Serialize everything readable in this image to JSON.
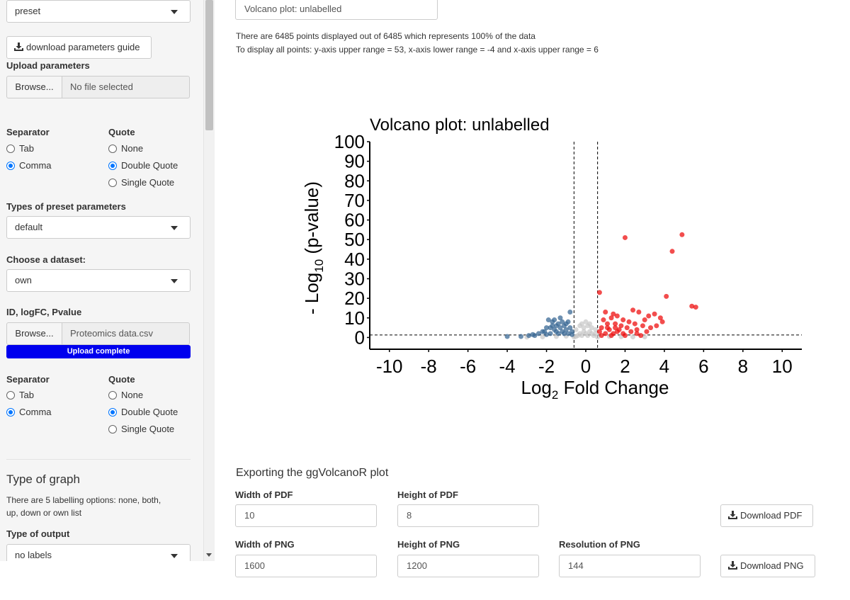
{
  "sidebar": {
    "preset_select": "preset",
    "download_guide_label": "download parameters guide",
    "upload_params_label": "Upload parameters",
    "browse_label": "Browse...",
    "no_file_text": "No file selected",
    "separator_label": "Separator",
    "quote_label": "Quote",
    "sep_tab": "Tab",
    "sep_comma": "Comma",
    "quote_none": "None",
    "quote_double": "Double Quote",
    "quote_single": "Single Quote",
    "types_preset_label": "Types of preset parameters",
    "types_preset_value": "default",
    "choose_dataset_label": "Choose a dataset:",
    "dataset_value": "own",
    "id_logfc_label": "ID, logFC, Pvalue",
    "data_file_name": "Proteomics data.csv",
    "upload_complete": "Upload complete",
    "upload_progress": 1.0,
    "type_of_graph_heading": "Type of graph",
    "labelling_options_line1": "There are 5 labelling options: none, both,",
    "labelling_options_line2": "up, down or own list",
    "type_of_output_label": "Type of output",
    "output_value": "no labels"
  },
  "main": {
    "title_input": "Volcano plot: unlabelled",
    "info_line1": "There are 6485 points displayed out of 6485 which represents 100% of the data",
    "info_line2": "To display all points: y-axis upper range = 53, x-axis lower range = -4 and x-axis upper range = 6",
    "export_heading": "Exporting the ggVolcanoR plot",
    "width_pdf_label": "Width of PDF",
    "width_pdf_value": "10",
    "height_pdf_label": "Height of PDF",
    "height_pdf_value": "8",
    "download_pdf_label": "Download PDF",
    "width_png_label": "Width of PNG",
    "width_png_value": "1600",
    "height_png_label": "Height of PNG",
    "height_png_value": "1200",
    "resolution_png_label": "Resolution of PNG",
    "resolution_png_value": "144",
    "download_png_label": "Download PNG"
  },
  "colors": {
    "up": "#ee1111",
    "down": "#3b6a96",
    "ns": "#c8c8c8",
    "progress": "#0000ee",
    "radio_checked": "#0075ff"
  },
  "chart_data": {
    "type": "scatter",
    "title": "Volcano plot: unlabelled",
    "xlabel": "Log2 Fold Change",
    "ylabel": "- Log10 (p-value)",
    "xlim": [
      -11,
      11
    ],
    "ylim": [
      -6,
      100
    ],
    "xticks": [
      -10,
      -8,
      -6,
      -4,
      -2,
      0,
      2,
      4,
      6,
      8,
      10
    ],
    "yticks": [
      0,
      10,
      20,
      30,
      40,
      50,
      60,
      70,
      80,
      90,
      100
    ],
    "vlines": [
      -0.6,
      0.6
    ],
    "hline": 1.3,
    "grid": false,
    "series": [
      {
        "name": "up",
        "color": "#ee1111",
        "points": [
          [
            2.0,
            51
          ],
          [
            4.9,
            52.5
          ],
          [
            4.4,
            44
          ],
          [
            0.7,
            23
          ],
          [
            4.1,
            21
          ],
          [
            5.4,
            16
          ],
          [
            5.6,
            15.5
          ],
          [
            2.4,
            14
          ],
          [
            2.7,
            13
          ],
          [
            1.4,
            12
          ],
          [
            3.2,
            11
          ],
          [
            3.5,
            12
          ],
          [
            3.8,
            10
          ],
          [
            3.0,
            9
          ],
          [
            3.9,
            8
          ],
          [
            2.5,
            7
          ],
          [
            2.9,
            6
          ],
          [
            3.3,
            5
          ],
          [
            3.6,
            6
          ],
          [
            3.1,
            3
          ],
          [
            2.6,
            4
          ],
          [
            1.0,
            13
          ],
          [
            1.6,
            11
          ],
          [
            1.3,
            10
          ],
          [
            1.9,
            9
          ],
          [
            2.2,
            8
          ],
          [
            0.9,
            9
          ],
          [
            1.1,
            7
          ],
          [
            1.5,
            7
          ],
          [
            1.8,
            6
          ],
          [
            2.1,
            5
          ],
          [
            0.8,
            5
          ],
          [
            1.2,
            4
          ],
          [
            1.7,
            4
          ],
          [
            2.3,
            3
          ],
          [
            0.7,
            3
          ],
          [
            1.0,
            2
          ],
          [
            1.4,
            2
          ],
          [
            1.9,
            2
          ],
          [
            0.8,
            1
          ],
          [
            1.3,
            1
          ],
          [
            1.6,
            3
          ],
          [
            2.0,
            1
          ],
          [
            2.6,
            2
          ],
          [
            2.8,
            1
          ],
          [
            1.1,
            5
          ],
          [
            1.5,
            5
          ]
        ]
      },
      {
        "name": "down",
        "color": "#3b6a96",
        "points": [
          [
            -4.0,
            0.5
          ],
          [
            -2.9,
            1
          ],
          [
            -2.7,
            1.5
          ],
          [
            -2.4,
            2
          ],
          [
            -2.1,
            3
          ],
          [
            -1.9,
            9
          ],
          [
            -1.8,
            5
          ],
          [
            -1.7,
            8
          ],
          [
            -1.6,
            4
          ],
          [
            -1.5,
            6
          ],
          [
            -1.4,
            7
          ],
          [
            -1.3,
            5
          ],
          [
            -1.2,
            3
          ],
          [
            -1.1,
            6
          ],
          [
            -1.0,
            4
          ],
          [
            -0.9,
            2
          ],
          [
            -0.8,
            5
          ],
          [
            -0.7,
            3
          ],
          [
            -0.8,
            13
          ],
          [
            -1.3,
            10
          ],
          [
            -1.6,
            9
          ],
          [
            -2.0,
            5
          ],
          [
            -2.2,
            3
          ],
          [
            -1.8,
            2
          ],
          [
            -1.1,
            2
          ],
          [
            -0.7,
            1.5
          ],
          [
            -1.5,
            3
          ],
          [
            -1.0,
            7
          ],
          [
            -1.4,
            2
          ],
          [
            -2.6,
            1
          ],
          [
            -3.3,
            0.5
          ],
          [
            -2.0,
            1.5
          ],
          [
            -0.9,
            8
          ],
          [
            -1.2,
            8
          ],
          [
            -1.7,
            6
          ]
        ]
      },
      {
        "name": "ns",
        "color": "#c8c8c8",
        "points": [
          [
            -0.5,
            0.5
          ],
          [
            -0.4,
            1
          ],
          [
            -0.3,
            2
          ],
          [
            -0.2,
            1
          ],
          [
            -0.1,
            3
          ],
          [
            0.0,
            2
          ],
          [
            0.1,
            1
          ],
          [
            0.2,
            3
          ],
          [
            0.3,
            2
          ],
          [
            0.4,
            1
          ],
          [
            0.5,
            2
          ],
          [
            -0.5,
            4
          ],
          [
            -0.3,
            6
          ],
          [
            -0.1,
            5
          ],
          [
            0.1,
            6
          ],
          [
            0.3,
            5
          ],
          [
            0.5,
            4
          ],
          [
            0.0,
            8
          ],
          [
            -0.2,
            7
          ],
          [
            0.2,
            7
          ],
          [
            -1.5,
            0.5
          ],
          [
            -1.0,
            0.7
          ],
          [
            -2.2,
            0.3
          ],
          [
            1.2,
            0.6
          ],
          [
            1.8,
            0.4
          ],
          [
            2.4,
            0.3
          ],
          [
            -0.6,
            0.2
          ],
          [
            0.6,
            0.2
          ],
          [
            -3.0,
            0.2
          ],
          [
            3.0,
            0.3
          ]
        ]
      }
    ]
  }
}
